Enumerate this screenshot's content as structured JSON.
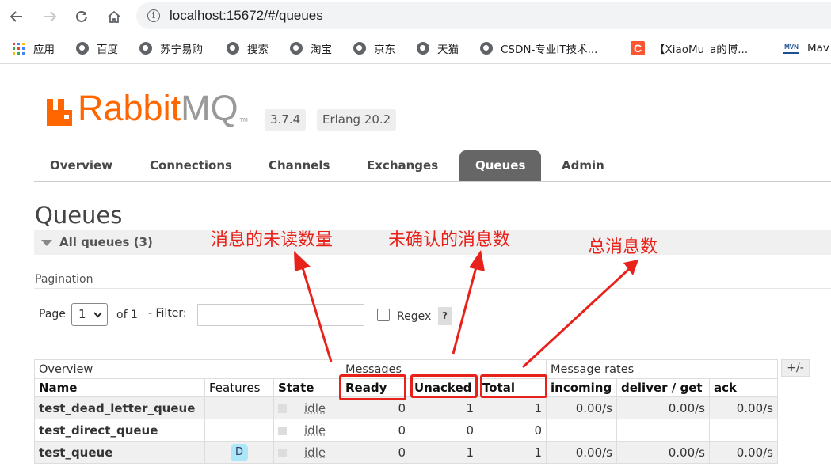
{
  "browser": {
    "url": "localhost:15672/#/queues",
    "bookmarks": [
      "应用",
      "百度",
      "苏宁易购",
      "搜索",
      "淘宝",
      "京东",
      "天猫",
      "CSDN-专业IT技术...",
      "【XiaoMu_a的博...",
      "Mav"
    ]
  },
  "app": {
    "logo_text": "Rabbit",
    "logo_text_mq": "MQ",
    "logo_tm": "TM",
    "version": "3.7.4",
    "erlang": "Erlang 20.2"
  },
  "tabs": [
    {
      "label": "Overview",
      "active": false
    },
    {
      "label": "Connections",
      "active": false
    },
    {
      "label": "Channels",
      "active": false
    },
    {
      "label": "Exchanges",
      "active": false
    },
    {
      "label": "Queues",
      "active": true
    },
    {
      "label": "Admin",
      "active": false
    }
  ],
  "page": {
    "title": "Queues",
    "section": "All queues (3)",
    "pagination_label": "Pagination",
    "page_label": "Page",
    "page_value": "1",
    "of_label": "of 1",
    "filter_label": "- Filter:",
    "filter_value": "",
    "regex_label": "Regex",
    "help": "?"
  },
  "table": {
    "groups": [
      "Overview",
      "Messages",
      "Message rates"
    ],
    "plus_minus": "+/-",
    "columns": [
      "Name",
      "Features",
      "State",
      "Ready",
      "Unacked",
      "Total",
      "incoming",
      "deliver / get",
      "ack"
    ],
    "rows": [
      {
        "name": "test_dead_letter_queue",
        "feature": "",
        "state": "idle",
        "ready": "0",
        "unacked": "1",
        "total": "1",
        "incoming": "0.00/s",
        "deliver": "0.00/s",
        "ack": "0.00/s"
      },
      {
        "name": "test_direct_queue",
        "feature": "",
        "state": "idle",
        "ready": "0",
        "unacked": "0",
        "total": "0",
        "incoming": "",
        "deliver": "",
        "ack": ""
      },
      {
        "name": "test_queue",
        "feature": "D",
        "state": "idle",
        "ready": "0",
        "unacked": "1",
        "total": "1",
        "incoming": "0.00/s",
        "deliver": "0.00/s",
        "ack": "0.00/s"
      }
    ]
  },
  "annotations": {
    "ready": "消息的未读数量",
    "unacked": "未确认的消息数",
    "total": "总消息数",
    "color": "#e8221b"
  }
}
